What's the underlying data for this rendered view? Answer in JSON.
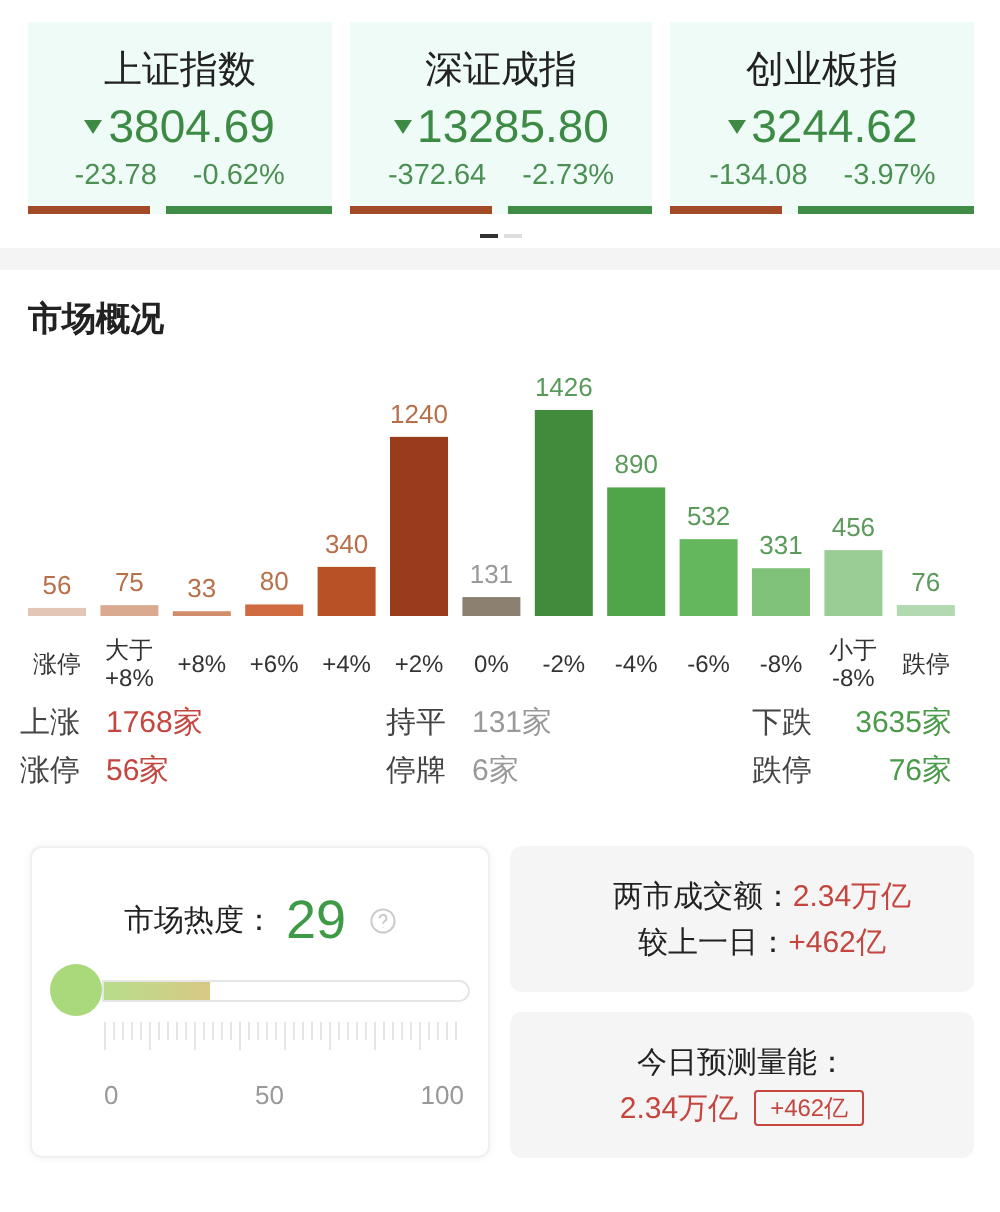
{
  "indices": [
    {
      "name": "上证指数",
      "value": "3804.69",
      "change": "-23.78",
      "percent": "-0.62%",
      "level": 0.4
    },
    {
      "name": "深证成指",
      "value": "13285.80",
      "change": "-372.64",
      "percent": "-2.73%",
      "level": 0.47
    },
    {
      "name": "创业板指",
      "value": "3244.62",
      "change": "-134.08",
      "percent": "-3.97%",
      "level": 0.37
    }
  ],
  "pages": [
    {
      "selected": true
    },
    {
      "selected": false
    }
  ],
  "market_overview": {
    "title": "市场概况",
    "chart_data": {
      "type": "bar",
      "categories": [
        "涨停",
        "大于 +8%",
        "+8%",
        "+6%",
        "+4%",
        "+2%",
        "0%",
        "-2%",
        "-4%",
        "-6%",
        "-8%",
        "小于 -8%",
        "跌停"
      ],
      "values": [
        56,
        75,
        33,
        80,
        340,
        1240,
        131,
        1426,
        890,
        532,
        331,
        456,
        76
      ],
      "data_labels": true
    },
    "stats": [
      {
        "items": [
          {
            "label": "上涨",
            "value": "1768家"
          },
          {
            "label": "涨停",
            "value": "56家"
          }
        ]
      },
      {
        "items": [
          {
            "label": "持平",
            "value": "131家"
          },
          {
            "label": "停牌",
            "value": "6家"
          }
        ]
      },
      {
        "items": [
          {
            "label": "下跌",
            "value": "3635家"
          },
          {
            "label": "跌停",
            "value": "76家"
          }
        ]
      }
    ]
  },
  "heat": {
    "label": "市场热度：",
    "value": "29",
    "level": 0.29,
    "ticks": [
      "0",
      "50",
      "100"
    ]
  },
  "turnover": {
    "lines": [
      {
        "label": "两市成交额：",
        "value": "2.34万亿"
      },
      {
        "label": "较上一日：",
        "value": "+462亿"
      }
    ]
  },
  "forecast": {
    "label": "今日预测量能：",
    "value": "2.34万亿",
    "change": "+462亿"
  }
}
